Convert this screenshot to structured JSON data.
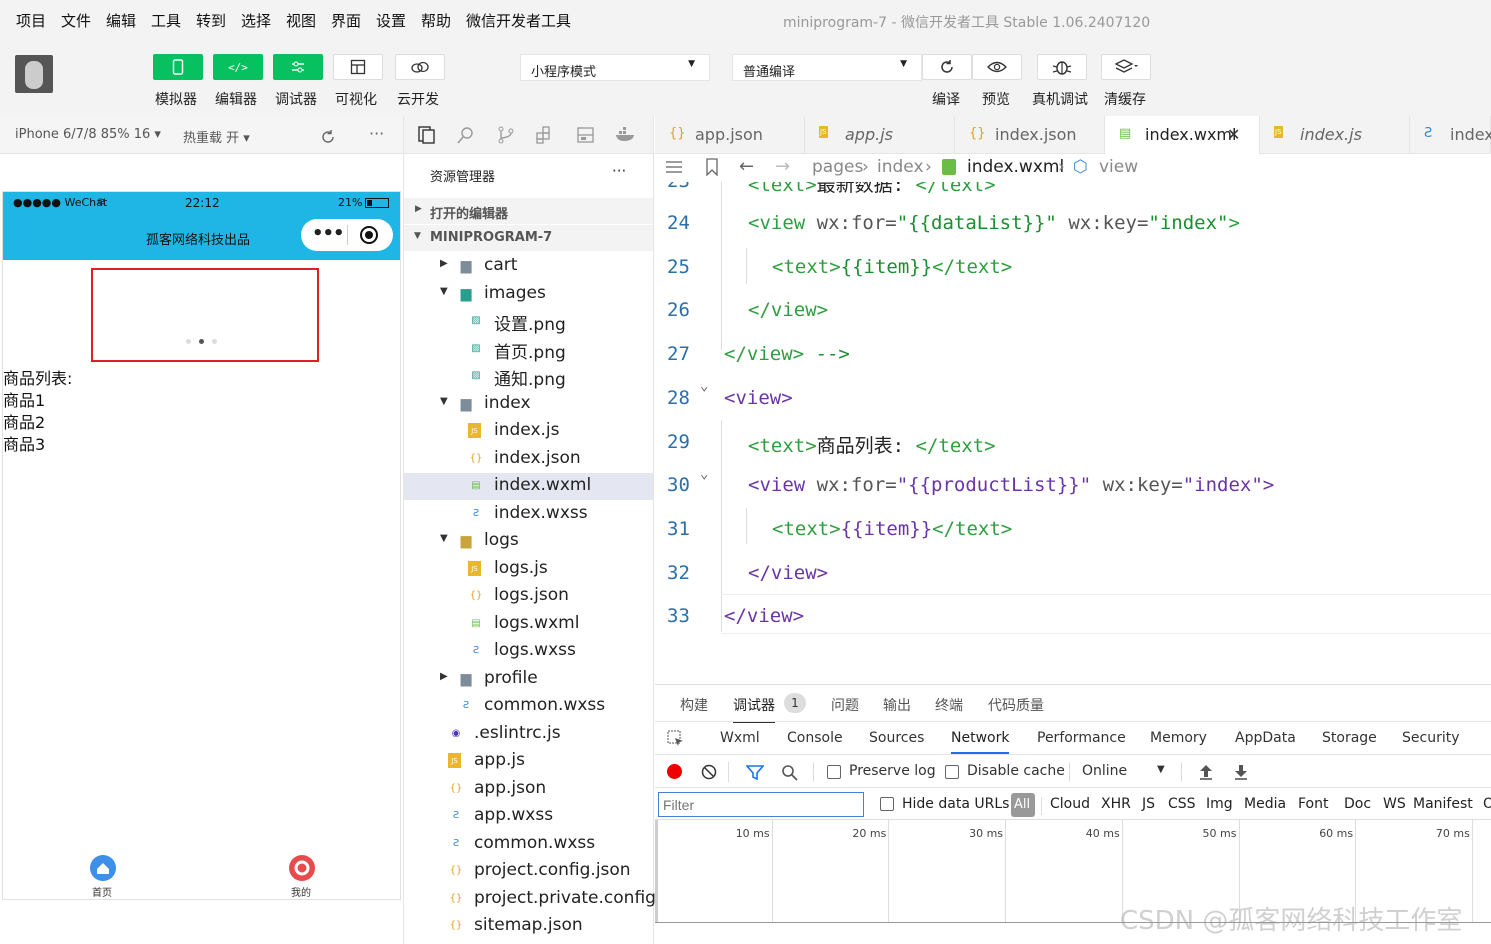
{
  "menu": [
    "项目",
    "文件",
    "编辑",
    "工具",
    "转到",
    "选择",
    "视图",
    "界面",
    "设置",
    "帮助",
    "微信开发者工具"
  ],
  "window_title": "miniprogram-7 - 微信开发者工具 Stable 1.06.2407120",
  "toolbar": {
    "buttons": [
      {
        "label": "模拟器",
        "icon": "phone-icon"
      },
      {
        "label": "编辑器",
        "icon": "code-icon"
      },
      {
        "label": "调试器",
        "icon": "debug-icon"
      },
      {
        "label": "可视化",
        "icon": "layout-icon"
      },
      {
        "label": "云开发",
        "icon": "cloud-icon"
      }
    ],
    "mode_select": "小程序模式",
    "compile_select": "普通编译",
    "actions": [
      {
        "label": "编译",
        "icon": "refresh-icon"
      },
      {
        "label": "预览",
        "icon": "eye-icon"
      },
      {
        "label": "真机调试",
        "icon": "bug-icon"
      },
      {
        "label": "清缓存",
        "icon": "layers-icon"
      }
    ]
  },
  "simulator": {
    "device": "iPhone 6/7/8 85% 16",
    "hot_reload": "热重载 开",
    "status_left": "●●●●● WeChat",
    "status_time": "22:12",
    "status_battery": "21%",
    "nav_title": "孤客网络科技出品",
    "content_lines": [
      "商品列表:",
      "商品1",
      "商品2",
      "商品3"
    ],
    "tabbar": [
      {
        "label": "首页",
        "icon": "home-icon",
        "color": "#3d8fe8"
      },
      {
        "label": "我的",
        "icon": "user-icon",
        "color": "#e84b4b"
      }
    ]
  },
  "explorer": {
    "title": "资源管理器",
    "more": "···",
    "open_editors": "打开的编辑器",
    "project": "MINIPROGRAM-7",
    "tree": [
      {
        "name": "cart",
        "type": "folder",
        "depth": 1,
        "arrow": "▸"
      },
      {
        "name": "images",
        "type": "folder-img",
        "depth": 1,
        "arrow": "▾"
      },
      {
        "name": "设置.png",
        "type": "png",
        "depth": 2
      },
      {
        "name": "首页.png",
        "type": "png",
        "depth": 2
      },
      {
        "name": "通知.png",
        "type": "png",
        "depth": 2
      },
      {
        "name": "index",
        "type": "folder",
        "depth": 1,
        "arrow": "▾"
      },
      {
        "name": "index.js",
        "type": "js",
        "depth": 2
      },
      {
        "name": "index.json",
        "type": "json",
        "depth": 2
      },
      {
        "name": "index.wxml",
        "type": "wxml",
        "depth": 2,
        "selected": true
      },
      {
        "name": "index.wxss",
        "type": "wxss",
        "depth": 2
      },
      {
        "name": "logs",
        "type": "folder-yellow",
        "depth": 1,
        "arrow": "▾"
      },
      {
        "name": "logs.js",
        "type": "js",
        "depth": 2
      },
      {
        "name": "logs.json",
        "type": "json",
        "depth": 2
      },
      {
        "name": "logs.wxml",
        "type": "wxml",
        "depth": 2
      },
      {
        "name": "logs.wxss",
        "type": "wxss",
        "depth": 2
      },
      {
        "name": "profile",
        "type": "folder",
        "depth": 1,
        "arrow": "▸"
      },
      {
        "name": "common.wxss",
        "type": "wxss",
        "depth": 1
      },
      {
        "name": ".eslintrc.js",
        "type": "eslint",
        "depth": 0
      },
      {
        "name": "app.js",
        "type": "js",
        "depth": 0
      },
      {
        "name": "app.json",
        "type": "json",
        "depth": 0
      },
      {
        "name": "app.wxss",
        "type": "wxss",
        "depth": 0
      },
      {
        "name": "common.wxss",
        "type": "wxss",
        "depth": 0
      },
      {
        "name": "project.config.json",
        "type": "json",
        "depth": 0
      },
      {
        "name": "project.private.config...",
        "type": "json",
        "depth": 0
      },
      {
        "name": "sitemap.json",
        "type": "json",
        "depth": 0
      }
    ]
  },
  "tabs": [
    {
      "name": "app.json",
      "type": "json"
    },
    {
      "name": "app.js",
      "type": "js"
    },
    {
      "name": "index.json",
      "type": "json"
    },
    {
      "name": "index.wxml",
      "type": "wxml",
      "active": true,
      "close": "✕"
    },
    {
      "name": "index.js",
      "type": "js"
    },
    {
      "name": "index.",
      "type": "wxss"
    }
  ],
  "breadcrumb": [
    "pages",
    "index",
    "index.wxml",
    "view"
  ],
  "code": [
    {
      "n": "23",
      "parts": [
        [
          "tg",
          "<text>"
        ],
        [
          "tx2",
          "最新数据: "
        ],
        [
          "tg",
          "</text>"
        ]
      ]
    },
    {
      "n": "24",
      "parts": [
        [
          "tg",
          "<view "
        ],
        [
          "at",
          "wx:for="
        ],
        [
          "ct",
          "\"{{dataList}}\" "
        ],
        [
          "at",
          "wx:key="
        ],
        [
          "ct",
          "\"index\""
        ],
        [
          "tg",
          ">"
        ]
      ]
    },
    {
      "n": "25",
      "parts": [
        [
          "tg",
          "<text>"
        ],
        [
          "ct",
          "{{item}}"
        ],
        [
          "tg",
          "</text>"
        ]
      ]
    },
    {
      "n": "26",
      "parts": [
        [
          "tg",
          "</view>"
        ]
      ]
    },
    {
      "n": "27",
      "parts": [
        [
          "tg",
          "</view>"
        ],
        [
          "tx2",
          " "
        ],
        [
          "ct",
          "-->"
        ]
      ]
    },
    {
      "n": "28",
      "parts": [
        [
          "vl",
          "<view>"
        ]
      ]
    },
    {
      "n": "29",
      "parts": [
        [
          "tg",
          "<text>"
        ],
        [
          "tx2",
          "商品列表: "
        ],
        [
          "tg",
          "</text>"
        ]
      ]
    },
    {
      "n": "30",
      "parts": [
        [
          "vl",
          "<view "
        ],
        [
          "at",
          "wx:for="
        ],
        [
          "vl",
          "\"{{productList}}\" "
        ],
        [
          "at",
          "wx:key="
        ],
        [
          "vl",
          "\"index\""
        ],
        [
          "vl",
          ">"
        ]
      ]
    },
    {
      "n": "31",
      "parts": [
        [
          "tg",
          "<text>"
        ],
        [
          "vl",
          "{{item}}"
        ],
        [
          "tg",
          "</text>"
        ]
      ]
    },
    {
      "n": "32",
      "parts": [
        [
          "vl",
          "</view>"
        ]
      ]
    },
    {
      "n": "33",
      "parts": [
        [
          "vl",
          "</view>"
        ]
      ]
    }
  ],
  "panel": {
    "tabs": [
      "构建",
      "调试器",
      "问题",
      "输出",
      "终端",
      "代码质量"
    ],
    "debugger_badge": "1",
    "devtools_tabs": [
      "Wxml",
      "Console",
      "Sources",
      "Network",
      "Performance",
      "Memory",
      "AppData",
      "Storage",
      "Security"
    ],
    "active_devtools_tab": "Network",
    "preserve_log": "Preserve log",
    "disable_cache": "Disable cache",
    "throttle": "Online",
    "filter_placeholder": "Filter",
    "hide_data_urls": "Hide data URLs",
    "filter_types": [
      "All",
      "Cloud",
      "XHR",
      "JS",
      "CSS",
      "Img",
      "Media",
      "Font",
      "Doc",
      "WS",
      "Manifest",
      "O"
    ],
    "timeline": [
      "10 ms",
      "20 ms",
      "30 ms",
      "40 ms",
      "50 ms",
      "60 ms",
      "70 ms"
    ]
  },
  "watermark": "CSDN @孤客网络科技工作室"
}
